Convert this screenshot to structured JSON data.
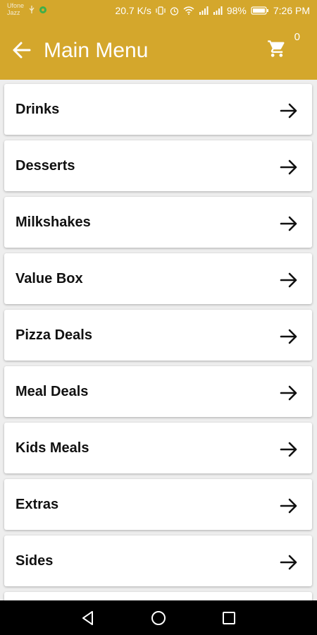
{
  "status_bar": {
    "carrier_line1": "Ufone",
    "carrier_line2": "Jazz",
    "speed": "20.7 K/s",
    "battery": "98%",
    "time": "7:26 PM"
  },
  "header": {
    "title": "Main Menu",
    "cart_count": "0"
  },
  "menu": {
    "items": [
      {
        "label": "Drinks"
      },
      {
        "label": "Desserts"
      },
      {
        "label": "Milkshakes"
      },
      {
        "label": "Value Box"
      },
      {
        "label": "Pizza Deals"
      },
      {
        "label": "Meal Deals"
      },
      {
        "label": "Kids Meals"
      },
      {
        "label": "Extras"
      },
      {
        "label": "Sides"
      },
      {
        "label": ""
      }
    ]
  },
  "icons": {
    "back": "arrow-left-icon",
    "cart": "shopping-cart-icon",
    "item_arrow": "arrow-right-icon",
    "nav_back": "triangle-back-icon",
    "nav_home": "circle-home-icon",
    "nav_recents": "square-recents-icon"
  },
  "colors": {
    "app_bar": "#d4a72c",
    "background": "#eeeeee",
    "card": "#ffffff",
    "nav_bar": "#000000"
  }
}
